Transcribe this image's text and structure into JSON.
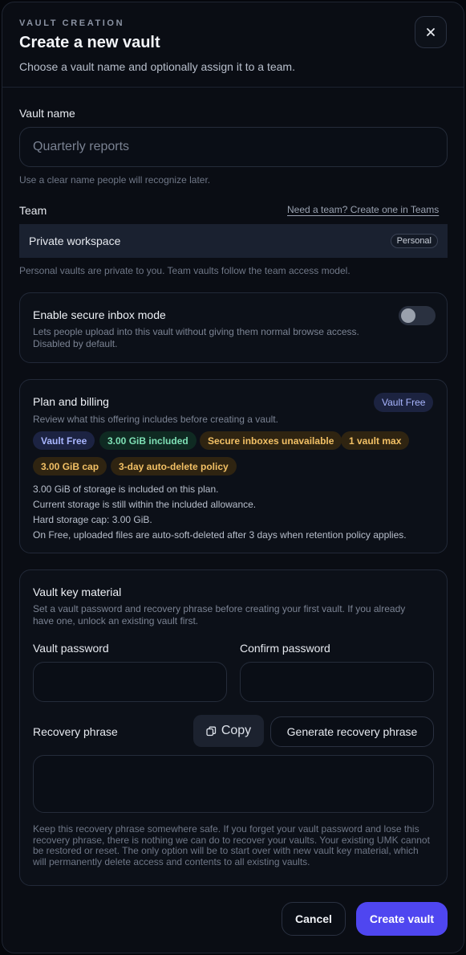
{
  "header": {
    "eyebrow": "VAULT CREATION",
    "title": "Create a new vault",
    "subtitle": "Choose a vault name and optionally assign it to a team."
  },
  "vault_name": {
    "label": "Vault name",
    "placeholder": "Quarterly reports",
    "value": "",
    "help": "Use a clear name people will recognize later."
  },
  "team": {
    "label": "Team",
    "link": "Need a team? Create one in Teams",
    "selected": "Private workspace",
    "badge": "Personal",
    "help": "Personal vaults are private to you. Team vaults follow the team access model."
  },
  "secure_inbox": {
    "title": "Enable secure inbox mode",
    "description_line1": "Lets people upload into this vault without giving them normal browse access.",
    "description_line2": "Disabled by default.",
    "enabled": false
  },
  "plan": {
    "title": "Plan and billing",
    "badge": "Vault Free",
    "description": "Review what this offering includes before creating a vault.",
    "pills": [
      {
        "label": "Vault Free",
        "tone": "blue"
      },
      {
        "label": "3.00 GiB included",
        "tone": "green"
      },
      {
        "label": "Secure inboxes unavailable",
        "tone": "amber"
      },
      {
        "label": "1 vault max",
        "tone": "amber"
      },
      {
        "label": "3.00 GiB cap",
        "tone": "amber"
      },
      {
        "label": "3-day auto-delete policy",
        "tone": "amber"
      }
    ],
    "lines": [
      "3.00 GiB of storage is included on this plan.",
      "Current storage is still within the included allowance.",
      "Hard storage cap: 3.00 GiB.",
      "On Free, uploaded files are auto-soft-deleted after 3 days when retention policy applies."
    ]
  },
  "key_material": {
    "title": "Vault key material",
    "description_line1": "Set a vault password and recovery phrase before creating your first vault. If you already",
    "description_line2": "have one, unlock an existing vault first.",
    "password_label": "Vault password",
    "confirm_label": "Confirm password",
    "recovery_label": "Recovery phrase",
    "copy_label": "Copy",
    "generate_label": "Generate recovery phrase",
    "recovery_value": "",
    "warning": "Keep this recovery phrase somewhere safe. If you forget your vault password and lose this recovery phrase, there is nothing we can do to recover your vaults. Your existing UMK cannot be restored or reset. The only option will be to start over with new vault key material, which will permanently delete access and contents to all existing vaults."
  },
  "footer": {
    "cancel_label": "Cancel",
    "create_label": "Create vault"
  },
  "colors": {
    "accent": "#4f46f0",
    "background": "#0a0d14",
    "pill_blue": "#a9b6ff",
    "pill_green": "#7ee0b5",
    "pill_amber": "#f2c065"
  }
}
